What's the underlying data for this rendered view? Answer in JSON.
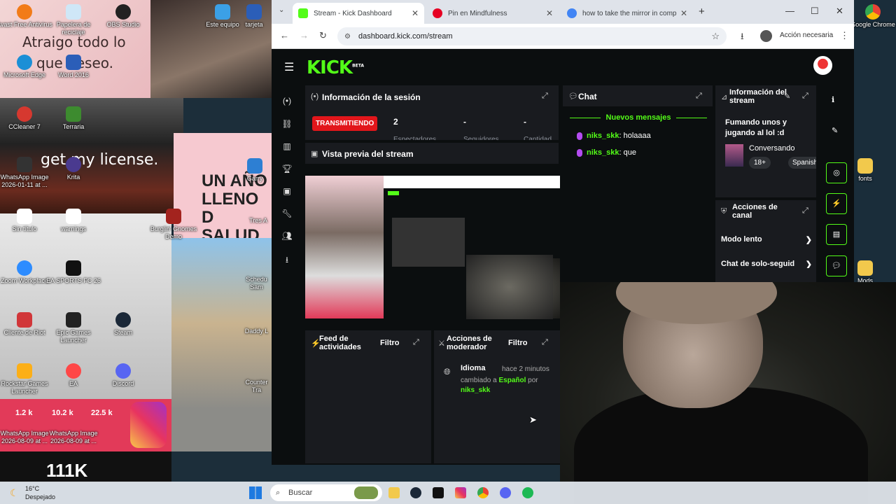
{
  "desktop": {
    "wallpaper_text": [
      "Atraigo todo lo",
      "que deseo."
    ],
    "license_text": "get my license.",
    "poster_text": [
      "UN AÑO",
      "LLENO D",
      "SALUD"
    ],
    "counter_text": "111K",
    "likes": [
      "1.2 k",
      "10.2 k",
      "22.5 k"
    ],
    "icons": [
      {
        "label": "Avast Free Antivirus"
      },
      {
        "label": "Papelera de reciclaje"
      },
      {
        "label": "OBS Studio"
      },
      {
        "label": "Este equipo"
      },
      {
        "label": "tarjeta"
      },
      {
        "label": "Microsoft Edge"
      },
      {
        "label": "Word 2016"
      },
      {
        "label": "CCleaner 7"
      },
      {
        "label": "Terraria"
      },
      {
        "label": "WhatsApp Image 2026-01-11 at ..."
      },
      {
        "label": "Krita"
      },
      {
        "label": "Garry"
      },
      {
        "label": "Sin título"
      },
      {
        "label": "warnings"
      },
      {
        "label": "Burglin' Gnomes Demo"
      },
      {
        "label": "Tres A"
      },
      {
        "label": "Zoom Workplace"
      },
      {
        "label": "EA SPORTS FC 26"
      },
      {
        "label": "Schedu Sam"
      },
      {
        "label": "Cliente de Riot"
      },
      {
        "label": "Epic Games Launcher"
      },
      {
        "label": "Steam"
      },
      {
        "label": "Daddy L"
      },
      {
        "label": "Rockstar Games Launcher"
      },
      {
        "label": "EA"
      },
      {
        "label": "Discord"
      },
      {
        "label": "Counter Tra"
      },
      {
        "label": "WhatsApp Image 2026-08-09 at ..."
      },
      {
        "label": "WhatsApp Image 2026-08-09 at ..."
      },
      {
        "label": "fonts"
      },
      {
        "label": "Mods"
      },
      {
        "label": "Google Chrome"
      }
    ]
  },
  "browser": {
    "tabs": [
      {
        "title": "Stream - Kick Dashboard",
        "color": "#53fc18"
      },
      {
        "title": "Pin en Mindfulness",
        "color": "#e60023"
      },
      {
        "title": "how to take the mirror in comput",
        "color": "#4285f4"
      }
    ],
    "url": "dashboard.kick.com/stream",
    "action_label": "Acción necesaria"
  },
  "kick": {
    "logo": "KICK",
    "logo_sup": "BETA",
    "session": {
      "title": "Información de la sesión",
      "live_badge": "TRANSMITIENDO",
      "stats": [
        {
          "value": "2",
          "label": "Espectadores"
        },
        {
          "value": "-",
          "label": "Seguidores"
        },
        {
          "value": "-",
          "label": "Cantidad"
        }
      ]
    },
    "chat": {
      "title": "Chat",
      "new_messages": "Nuevos mensajes",
      "messages": [
        {
          "user": "niks_skk",
          "text": "holaaaa"
        },
        {
          "user": "niks_skk",
          "text": "que"
        }
      ]
    },
    "stream_info": {
      "title": "Información del stream",
      "stream_title": "Fumando unos y jugando al lol :d",
      "category": "Conversando",
      "tags": [
        "18+",
        "Spanish"
      ]
    },
    "channel_actions": {
      "title": "Acciones de canal",
      "items": [
        "Modo lento",
        "Chat de solo-seguid"
      ]
    },
    "preview": {
      "title": "Vista previa del stream"
    },
    "activity": {
      "title": "Feed de actividades",
      "filter": "Filtro"
    },
    "moderator": {
      "title": "Acciones de moderador",
      "filter": "Filtro",
      "event": {
        "type": "Idioma",
        "time": "hace 2 minutos",
        "prefix": "cambiado a",
        "value": "Español",
        "by": "por",
        "user": "niks_skk"
      }
    }
  },
  "taskbar": {
    "weather_temp": "16°C",
    "weather_desc": "Despejado",
    "search_placeholder": "Buscar"
  }
}
